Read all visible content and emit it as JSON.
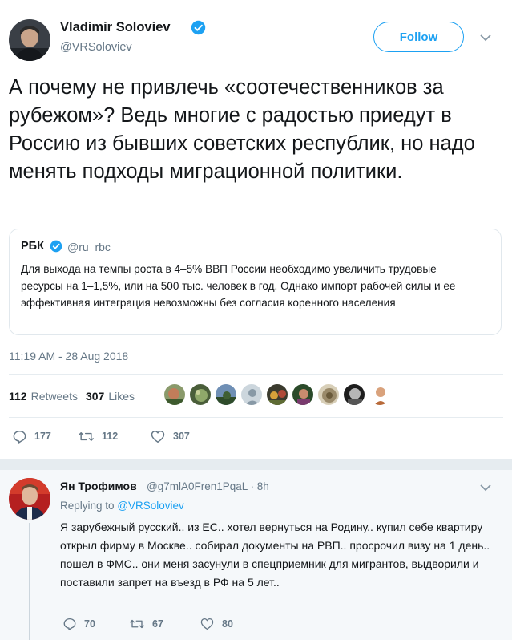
{
  "tweet": {
    "author": {
      "name": "Vladimir Soloviev",
      "handle": "@VRSoloviev",
      "verified": true
    },
    "follow_label": "Follow",
    "text": "А почему не привлечь «соотечественников за рубежом»? Ведь многие с радостью приедут в Россию из бывших советских республик, но надо менять подходы миграционной политики.",
    "quote": {
      "name": "РБК",
      "handle": "@ru_rbc",
      "verified": true,
      "text": "Для выхода на темпы роста в 4–5% ВВП России необходимо увеличить трудовые ресурсы на 1–1,5%, или на 500 тыс. человек в год. Однако импорт рабочей силы и ее эффективная интеграция невозможны без согласия коренного населения"
    },
    "timestamp": "11:19 AM - 28 Aug 2018",
    "stats": {
      "retweets_count": "112",
      "retweets_label": "Retweets",
      "likes_count": "307",
      "likes_label": "Likes"
    },
    "actions": {
      "replies": "177",
      "retweets": "112",
      "likes": "307"
    }
  },
  "reply": {
    "author": {
      "name": "Ян Трофимов",
      "handle": "@g7mlA0Fren1PqaL"
    },
    "time": "· 8h",
    "replying_prefix": "Replying to",
    "replying_to": "@VRSoloviev",
    "text": "Я зарубежный русский.. из ЕС.. хотел вернуться на Родину.. купил себе квартиру открыл фирму в Москве.. собирал документы на РВП.. просрочил визу на 1 день.. пошел в ФМС.. они меня засунули в спецприемник для мигрантов,  выдворили и поставили запрет на въезд в РФ на 5 лет..",
    "actions": {
      "replies": "70",
      "retweets": "67",
      "likes": "80"
    }
  },
  "colors": {
    "accent": "#1da1f2",
    "secondary_text": "#657786",
    "primary_text": "#14171a",
    "border": "#e1e8ed",
    "reply_background": "#f5f8fa"
  }
}
